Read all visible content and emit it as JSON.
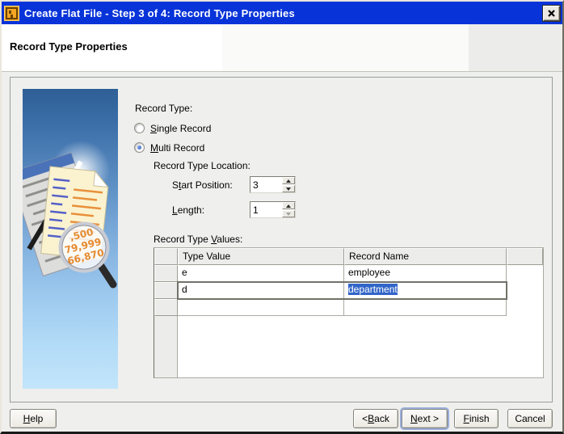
{
  "window": {
    "title": "Create Flat File - Step 3 of 4: Record Type Properties",
    "app_icon": "flat-file-wizard-icon",
    "close_icon": "x"
  },
  "header": {
    "title": "Record Type Properties"
  },
  "wizard_graphic": {
    "description": "wand-documents-magnifier-illustration",
    "magnifier_numbers": [
      ",500",
      "79,999",
      "66,870"
    ]
  },
  "form": {
    "record_type_label": "Record Type:",
    "single_record_radio": {
      "text": "Single Record",
      "mnemonic_index": 0,
      "selected": false
    },
    "multi_record_radio": {
      "text": "Multi Record",
      "mnemonic_index": 0,
      "selected": true
    },
    "location_label": "Record Type Location:",
    "start_position": {
      "label": {
        "text": "Start Position:",
        "mnemonic_index": 1
      },
      "value": "3"
    },
    "length": {
      "label": {
        "text": "Length:",
        "mnemonic_index": 0
      },
      "value": "1"
    },
    "values_label": {
      "text": "Record Type Values:",
      "mnemonic_index": 12
    }
  },
  "table": {
    "columns": {
      "type_value": "Type Value",
      "record_name": "Record Name"
    },
    "rows": [
      {
        "type_value": "e",
        "record_name": "employee"
      },
      {
        "type_value": "d",
        "record_name": "department",
        "editing": true,
        "selection": "department"
      },
      {
        "type_value": "",
        "record_name": ""
      }
    ]
  },
  "buttons": {
    "help": {
      "text": "Help",
      "mnemonic_index": 0
    },
    "back": {
      "text": "< Back",
      "mnemonic_index": 2
    },
    "next": {
      "text": "Next >",
      "mnemonic_index": 0
    },
    "finish": {
      "text": "Finish",
      "mnemonic_index": 0
    },
    "cancel": {
      "text": "Cancel",
      "mnemonic_index": -1
    }
  },
  "colors": {
    "titlebar_blue": "#0733D9",
    "selection_blue": "#3265C8",
    "panel_top_blue": "#2E5F96",
    "panel_bottom_blue": "#C2E5FA",
    "magnifier_number_orange": "#E58A2F"
  }
}
